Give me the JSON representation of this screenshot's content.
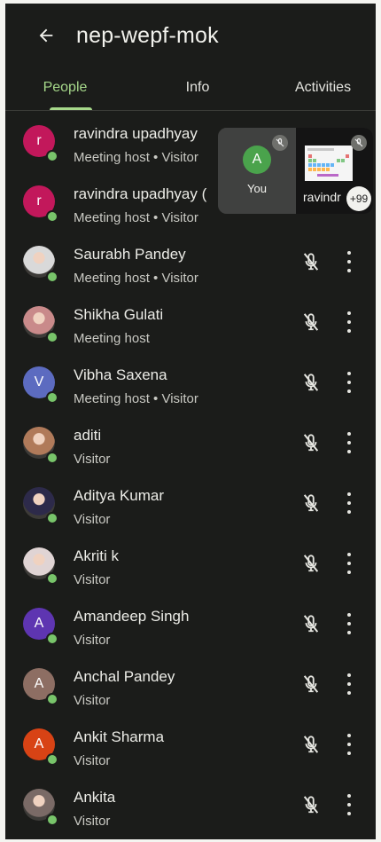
{
  "header": {
    "back_icon": "arrow-left-icon",
    "title": "nep-wepf-mok"
  },
  "tabs": [
    {
      "label": "People",
      "active": true
    },
    {
      "label": "Info",
      "active": false
    },
    {
      "label": "Activities",
      "active": false
    }
  ],
  "colors": {
    "accent": "#a6d88a",
    "background": "#1b1c1a",
    "online": "#78c46a"
  },
  "overlay": {
    "self": {
      "initial": "A",
      "label": "You"
    },
    "presenter": {
      "label": "ravindr",
      "more_count": "+99"
    }
  },
  "participants": [
    {
      "name": "ravindra upadhyay",
      "role": "Meeting host • Visitor",
      "initial": "r",
      "avatar_color": "#c2185b",
      "photo": false
    },
    {
      "name": "ravindra upadhyay (",
      "role": "Meeting host • Visitor",
      "initial": "r",
      "avatar_color": "#c2185b",
      "photo": false
    },
    {
      "name": "Saurabh Pandey",
      "role": "Meeting host • Visitor",
      "initial": "",
      "avatar_color": "#d9d9d9",
      "photo": true
    },
    {
      "name": "Shikha Gulati",
      "role": "Meeting host",
      "initial": "",
      "avatar_color": "#c98a8a",
      "photo": true
    },
    {
      "name": "Vibha Saxena",
      "role": "Meeting host • Visitor",
      "initial": "V",
      "avatar_color": "#5c6bc0",
      "photo": false
    },
    {
      "name": "aditi",
      "role": "Visitor",
      "initial": "",
      "avatar_color": "#b07a5a",
      "photo": true
    },
    {
      "name": "Aditya Kumar",
      "role": "Visitor",
      "initial": "",
      "avatar_color": "#2d2a4a",
      "photo": true
    },
    {
      "name": "Akriti k",
      "role": "Visitor",
      "initial": "",
      "avatar_color": "#e0d4d4",
      "photo": true
    },
    {
      "name": "Amandeep Singh",
      "role": "Visitor",
      "initial": "A",
      "avatar_color": "#5e35b1",
      "photo": false
    },
    {
      "name": "Anchal Pandey",
      "role": "Visitor",
      "initial": "A",
      "avatar_color": "#8d6e63",
      "photo": false
    },
    {
      "name": "Ankit Sharma",
      "role": "Visitor",
      "initial": "A",
      "avatar_color": "#d84315",
      "photo": false
    },
    {
      "name": "Ankita",
      "role": "Visitor",
      "initial": "",
      "avatar_color": "#7a6a66",
      "photo": true
    }
  ]
}
